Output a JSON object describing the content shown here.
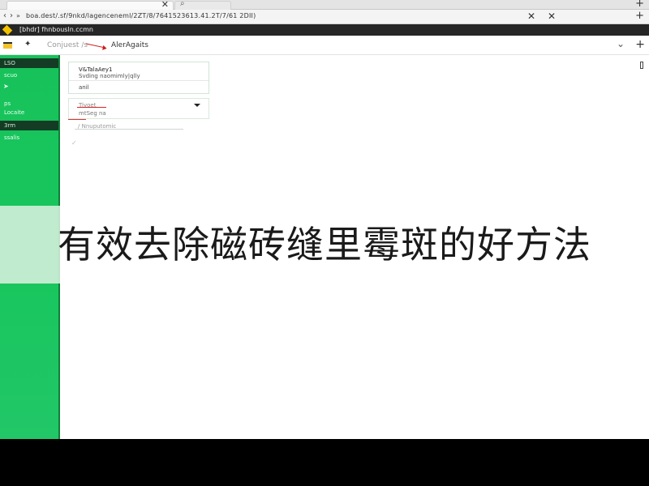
{
  "browser": {
    "tab_title": "",
    "url": "boa.dest/.sf/9nkd/lagenceneml/2ZT/8/7641523613.41.2T/7/61 2DII)",
    "account_bar_text": "[bhdr] fhnbousln.ccmn"
  },
  "header": {
    "breadcrumb": "Conjuest /s",
    "current": "AlerAgaits"
  },
  "sidebar": {
    "items": [
      {
        "label": "LSO",
        "type": "section"
      },
      {
        "label": "scuo",
        "type": "item"
      },
      {
        "label": "",
        "type": "icon-item",
        "icon": "send-icon"
      },
      {
        "label": "ps",
        "type": "item"
      },
      {
        "label": "Locaite",
        "type": "item"
      },
      {
        "label": "3rm",
        "type": "section"
      },
      {
        "label": "ssalis",
        "type": "item"
      }
    ]
  },
  "card": {
    "title": "V&TalaAey1",
    "subtitle": "Svding naomimly|qlly",
    "meta": "anil"
  },
  "dropdown": {
    "label": "Tivoet",
    "value": "mtSeg na"
  },
  "field": {
    "label": "/ Nnuputomic"
  },
  "caption": "有效去除磁砖缝里霉斑的好方法",
  "colors": {
    "sidebar_green": "#19c65e",
    "accent_red": "#cc1f1f",
    "account_bar": "#262626",
    "folder_yellow": "#f3c32b"
  }
}
